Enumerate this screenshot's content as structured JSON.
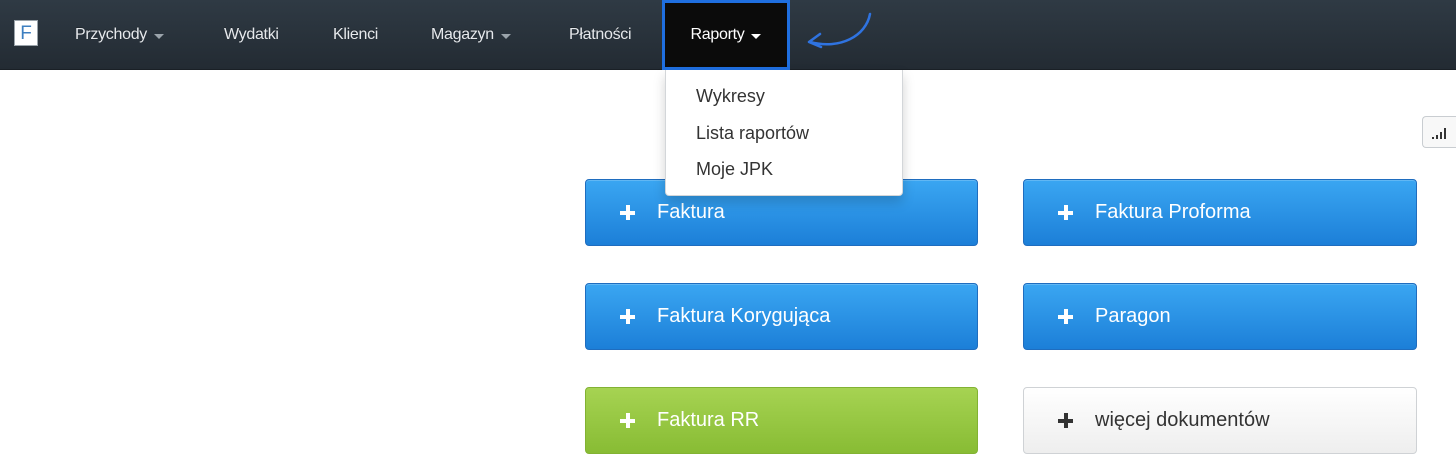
{
  "navbar": {
    "logo_letter": "F",
    "items": [
      {
        "label": "Przychody",
        "has_caret": true
      },
      {
        "label": "Wydatki",
        "has_caret": false
      },
      {
        "label": "Klienci",
        "has_caret": false
      },
      {
        "label": "Magazyn",
        "has_caret": true
      },
      {
        "label": "Płatności",
        "has_caret": false
      }
    ],
    "active_item": {
      "label": "Raporty",
      "has_caret": true
    },
    "highlight_color": "#1f6fe0"
  },
  "dropdown": {
    "items": [
      "Wykresy",
      "Lista raportów",
      "Moje JPK"
    ]
  },
  "toolbar": {
    "stats_icon": "signal-bars-icon"
  },
  "actions": [
    {
      "label": "Faktura",
      "style": "blue",
      "icon": "plus-icon"
    },
    {
      "label": "Faktura Proforma",
      "style": "blue",
      "icon": "plus-icon"
    },
    {
      "label": "Faktura Korygująca",
      "style": "blue",
      "icon": "plus-icon"
    },
    {
      "label": "Paragon",
      "style": "blue",
      "icon": "plus-icon"
    },
    {
      "label": "Faktura RR",
      "style": "green",
      "icon": "plus-icon"
    },
    {
      "label": "więcej dokumentów",
      "style": "default",
      "icon": "plus-icon"
    }
  ],
  "colors": {
    "navbar_bg": "#2a333c",
    "primary_blue": "#2590e5",
    "success_green": "#96c63f"
  }
}
